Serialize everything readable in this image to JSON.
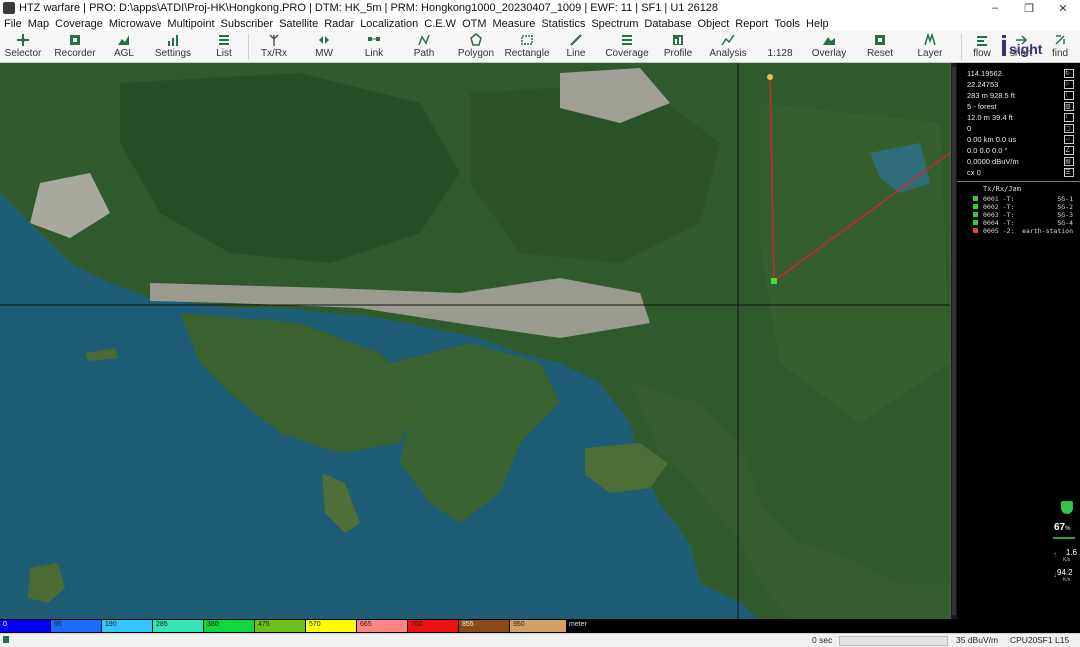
{
  "window": {
    "title": "HTZ warfare | PRO: D:\\apps\\ATDI\\Proj-HK\\Hongkong.PRO | DTM: HK_5m | PRM: Hongkong1000_20230407_1009 | EWF: 11 | SF1 | U1 26128",
    "controls": [
      "–",
      "❐",
      "✕"
    ]
  },
  "menu": [
    "File",
    "Map",
    "Coverage",
    "Microwave",
    "Multipoint",
    "Subscriber",
    "Satellite",
    "Radar",
    "Localization",
    "C.E.W",
    "OTM",
    "Measure",
    "Statistics",
    "Spectrum",
    "Database",
    "Object",
    "Report",
    "Tools",
    "Help"
  ],
  "toolbar": {
    "left": [
      {
        "label": "Selector",
        "icon": "selector-icon"
      },
      {
        "label": "Recorder",
        "icon": "recorder-icon"
      },
      {
        "label": "AGL",
        "icon": "agl-icon"
      },
      {
        "label": "Settings",
        "icon": "settings-icon"
      },
      {
        "label": "List",
        "icon": "list-icon"
      }
    ],
    "mid": [
      {
        "label": "Tx/Rx",
        "icon": "txrx-icon"
      },
      {
        "label": "MW",
        "icon": "mw-icon"
      },
      {
        "label": "Link",
        "icon": "link-icon"
      },
      {
        "label": "Path",
        "icon": "path-icon"
      },
      {
        "label": "Polygon",
        "icon": "polygon-icon"
      },
      {
        "label": "Rectangle",
        "icon": "rectangle-icon"
      },
      {
        "label": "Line",
        "icon": "line-icon"
      },
      {
        "label": "Coverage",
        "icon": "coverage-icon"
      },
      {
        "label": "Profile",
        "icon": "profile-icon"
      },
      {
        "label": "Analysis",
        "icon": "analysis-icon"
      },
      {
        "label": "1:128",
        "icon": "scale-icon"
      },
      {
        "label": "Overlay",
        "icon": "overlay-icon"
      },
      {
        "label": "Reset",
        "icon": "reset-icon"
      },
      {
        "label": "Layer",
        "icon": "layer-icon"
      }
    ],
    "right": [
      {
        "label": "flow",
        "icon": "flow-icon"
      },
      {
        "label": "short",
        "icon": "short-icon"
      },
      {
        "label": "find",
        "icon": "find-icon"
      }
    ],
    "logo_text": "Insight"
  },
  "info_panel": {
    "rows": [
      {
        "text": "114.19562",
        "icon": "↻"
      },
      {
        "text": "22.24753",
        "icon": "⌂"
      },
      {
        "text": "283 m 928.5 ft",
        "icon": "↑"
      },
      {
        "text": "5 - forest",
        "icon": "▥"
      },
      {
        "text": "12.0 m 39.4 ft",
        "icon": "↕"
      },
      {
        "text": "0",
        "icon": "▢"
      },
      {
        "text": "0.00 km 0.0 us",
        "icon": "↔"
      },
      {
        "text": "0.0 0.0 0.0 °",
        "icon": "∠"
      },
      {
        "text": "0.0000 dBuV/m",
        "icon": "▤"
      },
      {
        "text": "cx 0",
        "icon": "☰"
      }
    ],
    "trx_header": "Tx/Rx/Jam",
    "trx": [
      {
        "id": "0001 -T:",
        "name": "5G-1",
        "color": "#2fcf2f"
      },
      {
        "id": "0002 -T:",
        "name": "5G-2",
        "color": "#2fcf2f"
      },
      {
        "id": "0003 -T:",
        "name": "5G-3",
        "color": "#2fcf2f"
      },
      {
        "id": "0004 -T:",
        "name": "5G-4",
        "color": "#2fcf2f"
      },
      {
        "id": "0005 -2:",
        "name": "earth-station",
        "color": "#d05050"
      }
    ],
    "cpu_percent": "67",
    "cpu_unit": "%",
    "net_up": "1.6",
    "net_up_unit": "K/s",
    "net_down": "94.2",
    "net_down_unit": "K/s"
  },
  "legend": {
    "bands": [
      {
        "label": "0",
        "color": "#0000ff"
      },
      {
        "label": "95",
        "color": "#1a6cff"
      },
      {
        "label": "190",
        "color": "#34c7ff"
      },
      {
        "label": "285",
        "color": "#33e6b5"
      },
      {
        "label": "380",
        "color": "#10d83c"
      },
      {
        "label": "475",
        "color": "#6cc21c"
      },
      {
        "label": "570",
        "color": "#ffff00"
      },
      {
        "label": "665",
        "color": "#ff8585"
      },
      {
        "label": "760",
        "color": "#ee1111"
      },
      {
        "label": "855",
        "color": "#8a4a18"
      },
      {
        "label": "950",
        "color": "#d4a064"
      }
    ],
    "unit": "meter"
  },
  "status": {
    "time": "0 sec",
    "field": "35 dBuV/m",
    "cpu": "CPU20",
    "sf": "SF1",
    "layer": "L15"
  }
}
